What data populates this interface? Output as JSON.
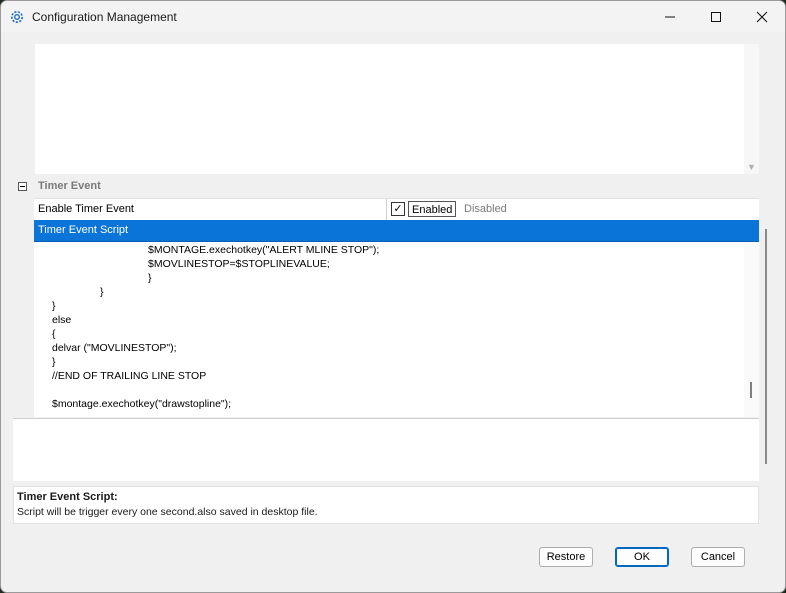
{
  "window": {
    "title": "Configuration Management",
    "icon": "gear-icon"
  },
  "category": {
    "label": "Timer Event",
    "toggle_symbol": "−"
  },
  "properties": [
    {
      "name": "Enable Timer Event",
      "checked": true,
      "option_enabled": "Enabled",
      "option_disabled": "Disabled"
    },
    {
      "name": "Timer Event Script",
      "selected": true
    }
  ],
  "script_lines": [
    {
      "indent": 96,
      "text": "$MONTAGE.exechotkey(\"ALERT MLINE STOP\");"
    },
    {
      "indent": 96,
      "text": "$MOVLINESTOP=$STOPLINEVALUE;"
    },
    {
      "indent": 96,
      "text": "}"
    },
    {
      "indent": 48,
      "text": "}"
    },
    {
      "indent": 0,
      "text": "}"
    },
    {
      "indent": 0,
      "text": "else"
    },
    {
      "indent": 0,
      "text": "{"
    },
    {
      "indent": 0,
      "text": "delvar (\"MOVLINESTOP\");"
    },
    {
      "indent": 0,
      "text": "}"
    },
    {
      "indent": 0,
      "text": "//END OF TRAILING LINE STOP"
    },
    {
      "indent": 0,
      "text": ""
    },
    {
      "indent": 0,
      "text": "$montage.exechotkey(\"drawstopline\");"
    }
  ],
  "help": {
    "title": "Timer Event Script:",
    "description": "Script will be trigger every one second.also saved in desktop file."
  },
  "buttons": {
    "restore": "Restore",
    "ok": "OK",
    "cancel": "Cancel"
  },
  "colors": {
    "selection": "#0a74d9",
    "primary_button_border": "#0067c0"
  }
}
